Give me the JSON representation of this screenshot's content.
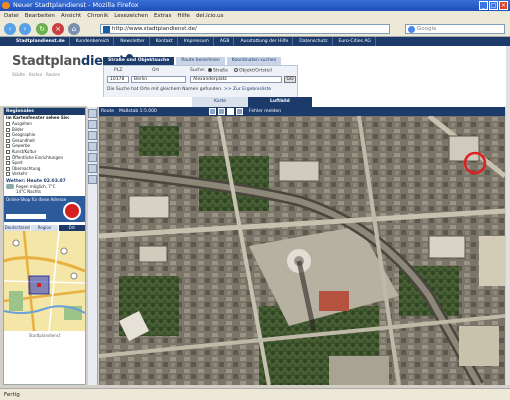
{
  "window": {
    "title": "Neuer Stadtplandienst - Mozilla Firefox",
    "controls": [
      "_",
      "□",
      "×"
    ]
  },
  "menu": [
    "Datei",
    "Bearbeiten",
    "Ansicht",
    "Chronik",
    "Lesezeichen",
    "Extras",
    "Hilfe",
    "del.icio.us"
  ],
  "toolbar": {
    "url": "http://www.stadtplandienst.de/",
    "search_placeholder": "Google"
  },
  "site_nav": [
    "Stadtplandienst.de",
    "Kundenbereich",
    "Newsletter",
    "Kontakt",
    "Impressum",
    "AGB",
    "Ausstattung der Hilfe",
    "Datenschutz",
    "Euro-Cities AG"
  ],
  "logo": {
    "text_a": "Stadtplan",
    "text_b": "dienst",
    "sub": "Städte · Karten · Routen"
  },
  "search": {
    "tabs": [
      "Straße und Objektsuche",
      "Route berechnen",
      "Koordinaten suchen"
    ],
    "plz_label": "PLZ",
    "ort_label": "Ort",
    "suche_label": "Suche:",
    "radio_strasse": "Straße",
    "radio_objekt": "Objekt/Ortsteil",
    "plz_value": "10178",
    "ort_value": "Berlin",
    "street_value": "Alexanderplatz",
    "go": "GO",
    "message": "Die Suche hat Orte mit gleichem Namen gefunden.",
    "results_link": ">> Zur Ergebnisliste"
  },
  "map_view_tabs": [
    "Karte",
    "Luftbild"
  ],
  "map_toolbar": {
    "route": "Route",
    "scale": "Maßstab 1:5.000",
    "fullscreen": "Fehler melden"
  },
  "sidebar": {
    "heading": "Regionales",
    "subheading": "Im Kartenfenster sehen Sie:",
    "categories": [
      "Ausgehen",
      "Bilder",
      "Geographie",
      "Gesundheit",
      "Gewerbe",
      "Kunst/Kultur",
      "Öffentliche Einrichtungen",
      "Sport",
      "Übernachtung",
      "Verkehr"
    ],
    "weather_title": "Wetter: Heute 02.03.07",
    "weather_line1": "Regen möglich, 7°C",
    "weather_line2": "14°C Nachts",
    "ad_title": "Online-Shop für diese Adresse"
  },
  "overview": {
    "tabs": [
      "Deutschland",
      "Region",
      "Ort"
    ],
    "footer": "Stadtplandienst"
  },
  "status": "Fertig"
}
